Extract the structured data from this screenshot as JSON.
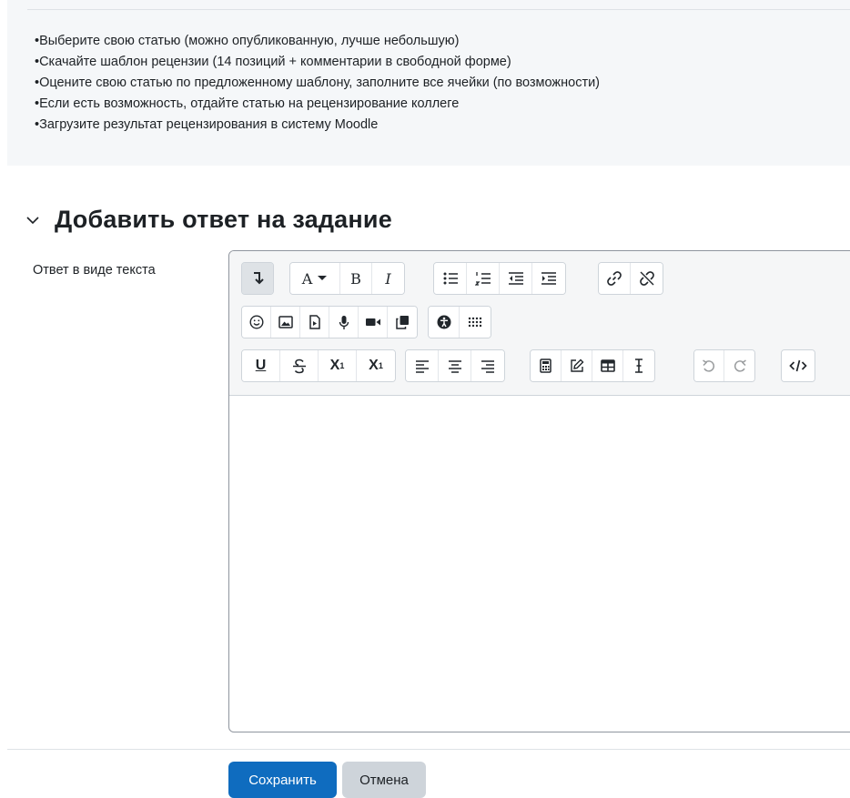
{
  "instructions": [
    "•Выберите свою статью (можно опубликованную, лучше небольшую)",
    "•Скачайте шаблон рецензии (14 позиций + комментарии в свободной форме)",
    "•Оцените свою статью по предложенному шаблону, заполните все ячейки (по возможности)",
    "•Если есть возможность, отдайте статью на рецензирование коллеге",
    "•Загрузите результат рецензирования в систему Moodle"
  ],
  "section": {
    "title": "Добавить ответ на задание",
    "field_label": "Ответ в виде текста"
  },
  "toolbar": {
    "font_size_label": "A",
    "bold_label": "B",
    "italic_label": "I",
    "underline_label": "U",
    "sub_label": "X",
    "sup_label": "X"
  },
  "editor": {
    "content": ""
  },
  "actions": {
    "save_label": "Сохранить",
    "cancel_label": "Отмена"
  },
  "colors": {
    "primary": "#0f6cbf",
    "secondary": "#ced4da",
    "info_bg": "#f5f7f9"
  }
}
